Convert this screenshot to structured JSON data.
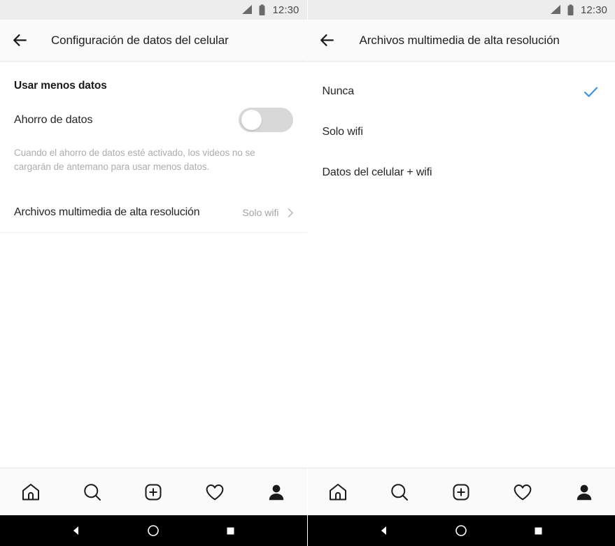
{
  "colors": {
    "accent_check": "#3e93e0",
    "status_bar_bg": "#ededed",
    "app_bar_bg": "#fafafa",
    "toggle_track_off": "#d8d8d8",
    "primary_text": "#262626",
    "secondary_text": "#a3a3a3",
    "description_text": "#adadad"
  },
  "status_bar": {
    "time": "12:30",
    "signal_icon": "signal-triangle-icon",
    "battery_icon": "battery-icon"
  },
  "left_panel": {
    "app_bar": {
      "back_icon": "back-arrow-icon",
      "title": "Configuración de datos del celular"
    },
    "section_heading": "Usar menos datos",
    "toggle_row": {
      "label": "Ahorro de datos",
      "state": "off"
    },
    "description": "Cuando el ahorro de datos esté activado, los videos no se cargarán de antemano para usar menos datos.",
    "link_row": {
      "label": "Archivos multimedia de alta resolución",
      "value": "Solo wifi",
      "chevron_icon": "chevron-right-icon"
    }
  },
  "right_panel": {
    "app_bar": {
      "back_icon": "back-arrow-icon",
      "title": "Archivos multimedia de alta resolución"
    },
    "options": [
      {
        "label": "Nunca",
        "selected": true
      },
      {
        "label": "Solo wifi",
        "selected": false
      },
      {
        "label": "Datos del celular + wifi",
        "selected": false
      }
    ]
  },
  "tab_bar": {
    "items": [
      {
        "icon": "home-icon",
        "name": "tab-home"
      },
      {
        "icon": "search-icon",
        "name": "tab-search"
      },
      {
        "icon": "add-post-icon",
        "name": "tab-add-post"
      },
      {
        "icon": "heart-icon",
        "name": "tab-activity"
      },
      {
        "icon": "profile-icon",
        "name": "tab-profile"
      }
    ]
  },
  "android_nav": {
    "items": [
      {
        "icon": "android-back-icon",
        "name": "android-back-button"
      },
      {
        "icon": "android-home-icon",
        "name": "android-home-button"
      },
      {
        "icon": "android-recents-icon",
        "name": "android-recents-button"
      }
    ]
  }
}
